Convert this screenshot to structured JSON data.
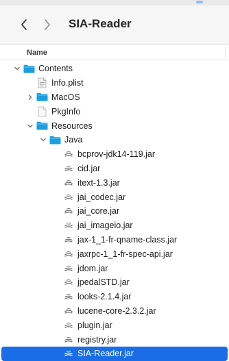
{
  "window": {
    "title": "SIA-Reader"
  },
  "columns": {
    "name": "Name"
  },
  "colors": {
    "folder": "#1b9ee0",
    "selection": "#1a6de6",
    "toolbar_bg": "#f6f6f6"
  },
  "rows": [
    {
      "label": "Contents",
      "kind": "folder",
      "level": 0,
      "expanded": true
    },
    {
      "label": "Info.plist",
      "kind": "plist-file",
      "level": 1
    },
    {
      "label": "MacOS",
      "kind": "folder",
      "level": 1,
      "expanded": false
    },
    {
      "label": "PkgInfo",
      "kind": "blank-file",
      "level": 1
    },
    {
      "label": "Resources",
      "kind": "folder",
      "level": 1,
      "expanded": true
    },
    {
      "label": "Java",
      "kind": "folder",
      "level": 2,
      "expanded": true
    },
    {
      "label": "bcprov-jdk14-119.jar",
      "kind": "jar",
      "level": 3
    },
    {
      "label": "cid.jar",
      "kind": "jar",
      "level": 3
    },
    {
      "label": "itext-1.3.jar",
      "kind": "jar",
      "level": 3
    },
    {
      "label": "jai_codec.jar",
      "kind": "jar",
      "level": 3
    },
    {
      "label": "jai_core.jar",
      "kind": "jar",
      "level": 3
    },
    {
      "label": "jai_imageio.jar",
      "kind": "jar",
      "level": 3
    },
    {
      "label": "jax-1_1-fr-qname-class.jar",
      "kind": "jar",
      "level": 3
    },
    {
      "label": "jaxrpc-1_1-fr-spec-api.jar",
      "kind": "jar",
      "level": 3
    },
    {
      "label": "jdom.jar",
      "kind": "jar",
      "level": 3
    },
    {
      "label": "jpedalSTD.jar",
      "kind": "jar",
      "level": 3
    },
    {
      "label": "looks-2.1.4.jar",
      "kind": "jar",
      "level": 3
    },
    {
      "label": "lucene-core-2.3.2.jar",
      "kind": "jar",
      "level": 3
    },
    {
      "label": "plugin.jar",
      "kind": "jar",
      "level": 3
    },
    {
      "label": "registry.jar",
      "kind": "jar",
      "level": 3
    },
    {
      "label": "SIA-Reader.jar",
      "kind": "jar",
      "level": 3,
      "selected": true
    }
  ]
}
